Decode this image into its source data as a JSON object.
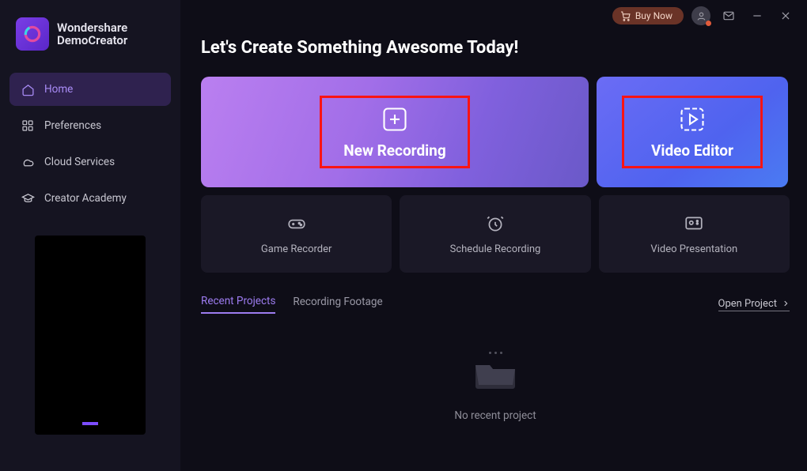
{
  "titlebar": {
    "buy_label": "Buy Now"
  },
  "brand": {
    "line1": "Wondershare",
    "line2": "DemoCreator"
  },
  "nav": {
    "home": "Home",
    "preferences": "Preferences",
    "cloud": "Cloud Services",
    "academy": "Creator Academy"
  },
  "headline": "Let's Create Something Awesome Today!",
  "hero": {
    "recording": "New Recording",
    "editor": "Video Editor"
  },
  "features": {
    "game": "Game Recorder",
    "schedule": "Schedule Recording",
    "presentation": "Video Presentation"
  },
  "tabs": {
    "recent": "Recent Projects",
    "footage": "Recording Footage",
    "open": "Open Project"
  },
  "empty_label": "No recent project"
}
